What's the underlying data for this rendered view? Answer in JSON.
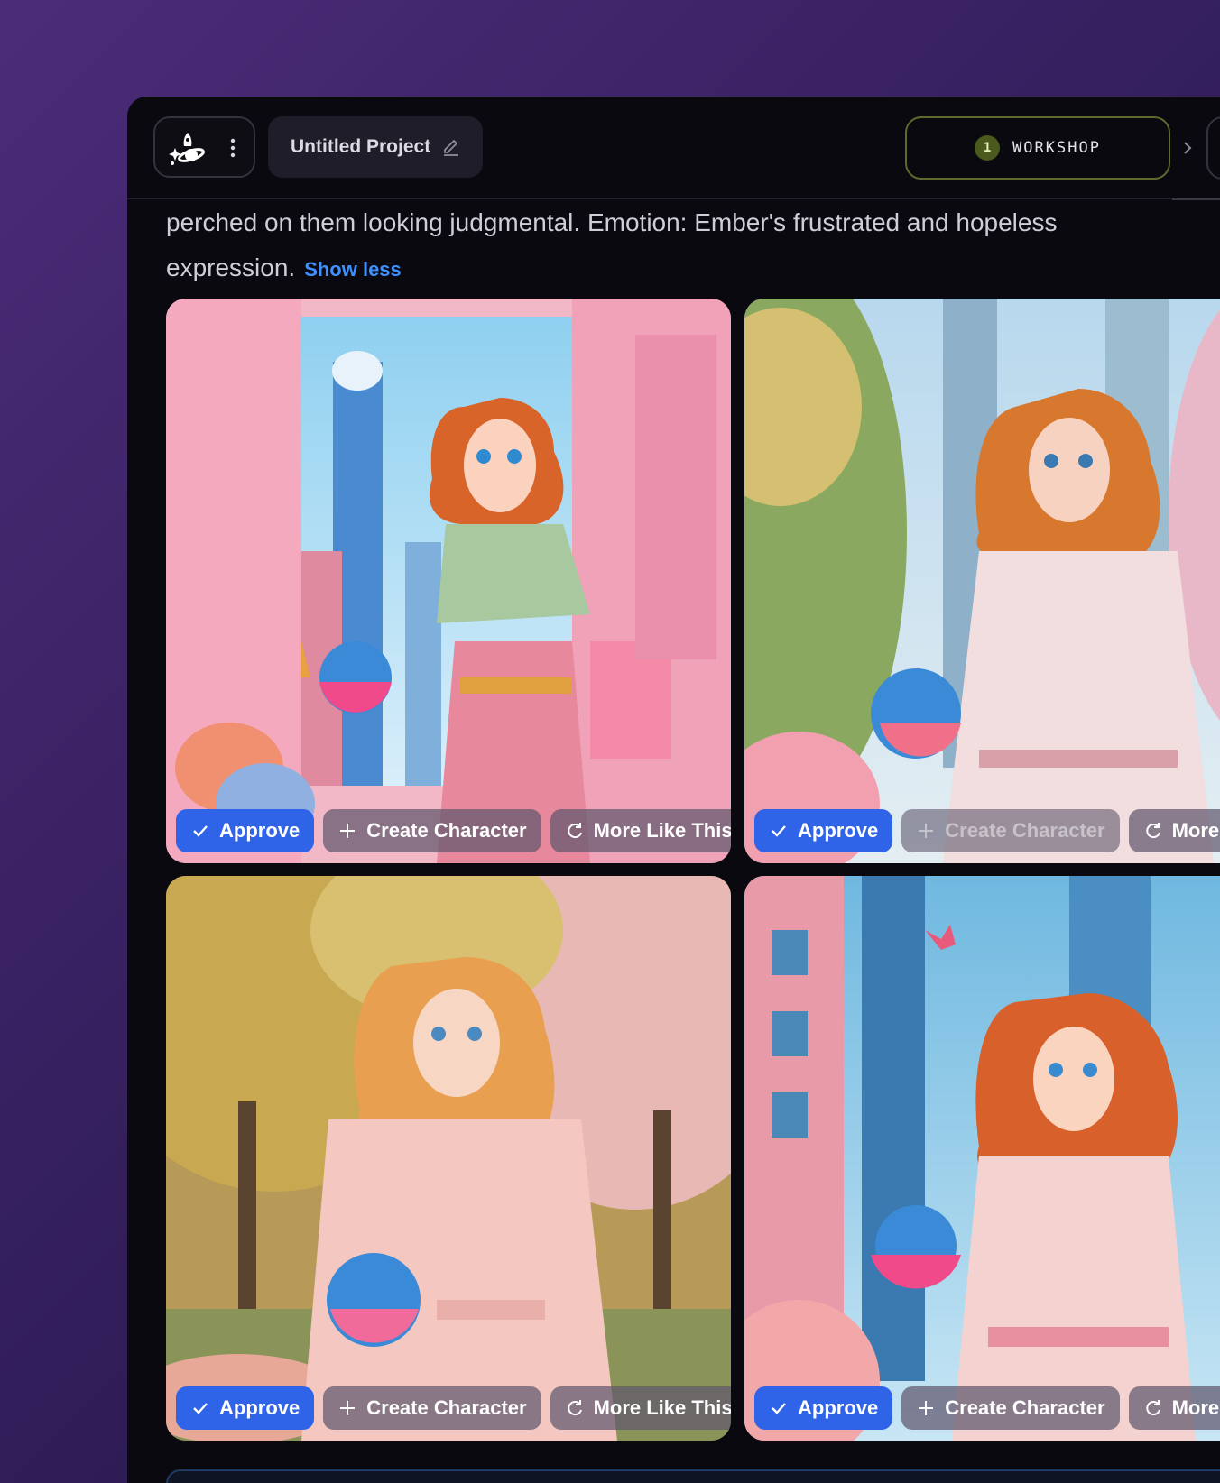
{
  "header": {
    "project_title": "Untitled Project",
    "workshop_step": "1",
    "workshop_label": "WORKSHOP"
  },
  "description": {
    "text": "perched on them looking judgmental. Emotion: Ember's frustrated and hopeless expression.",
    "toggle_label": "Show less"
  },
  "cards": [
    {
      "approve": "Approve",
      "create": "Create Character",
      "more": "More Like This",
      "scene": "pink-room"
    },
    {
      "approve": "Approve",
      "create": "Create Character",
      "more": "More Like This",
      "scene": "park-city",
      "create_disabled": true
    },
    {
      "approve": "Approve",
      "create": "Create Character",
      "more": "More Like This",
      "scene": "autumn-park"
    },
    {
      "approve": "Approve",
      "create": "Create Character",
      "more": "More Like This",
      "scene": "city-sky"
    }
  ],
  "colors": {
    "accent_blue": "#2f63e8",
    "link_blue": "#3f8fff",
    "workshop_border": "#5f6a2a",
    "app_bg": "#0a0910"
  },
  "icons": [
    "rocket-planet-logo-icon",
    "kebab-menu-icon",
    "pencil-icon",
    "chevron-right-icon",
    "check-icon",
    "plus-icon",
    "refresh-icon"
  ]
}
